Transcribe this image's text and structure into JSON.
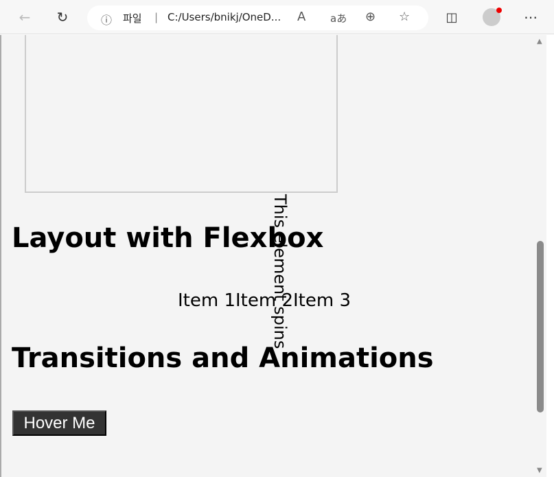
{
  "browser": {
    "site_label": "파일",
    "url": "C:/Users/bnikj/OneD...",
    "icons": [
      "back-arrow-icon",
      "refresh-icon",
      "info-icon",
      "read-aloud-icon",
      "translate-icon",
      "zoom-icon",
      "favorite-star-icon",
      "split-screen-icon",
      "profile-avatar-icon",
      "more-menu-icon"
    ],
    "notification_color": "#e00000"
  },
  "page": {
    "heading_flexbox": "Layout with Flexbox",
    "flex_items": [
      "Item 1",
      "Item 2",
      "Item 3"
    ],
    "spin_text": "This element spins",
    "heading_transitions": "Transitions and Animations",
    "hover_button": "Hover Me",
    "background": "#f4f4f4",
    "button_color": "#333333"
  }
}
